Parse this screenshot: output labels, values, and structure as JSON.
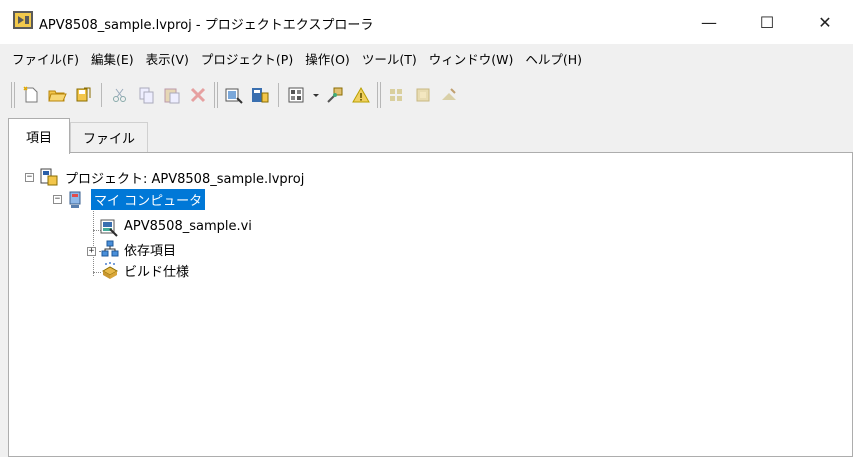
{
  "window": {
    "title": "APV8508_sample.lvproj - プロジェクトエクスプローラ",
    "minimize_glyph": "—",
    "maximize_glyph": "☐",
    "close_glyph": "✕"
  },
  "menu": [
    {
      "label": "ファイル(F)"
    },
    {
      "label": "編集(E)"
    },
    {
      "label": "表示(V)"
    },
    {
      "label": "プロジェクト(P)"
    },
    {
      "label": "操作(O)"
    },
    {
      "label": "ツール(T)"
    },
    {
      "label": "ウィンドウ(W)"
    },
    {
      "label": "ヘルプ(H)"
    }
  ],
  "toolbar": {
    "icons": [
      "new-icon",
      "open-icon",
      "save-all-icon",
      "cut-icon",
      "copy-icon",
      "paste-icon",
      "delete-icon",
      "build-icon",
      "vi-properties-icon",
      "view-options-icon",
      "deploy-icon",
      "warning-icon",
      "build-spec-icon",
      "add-file-icon",
      "remove-icon"
    ]
  },
  "tabs": [
    {
      "label": "項目",
      "active": true
    },
    {
      "label": "ファイル",
      "active": false
    }
  ],
  "tree": {
    "project": {
      "label": "プロジェクト: APV8508_sample.lvproj",
      "expanded": true
    },
    "computer": {
      "label": "マイ コンピュータ",
      "selected": true,
      "expanded": true
    },
    "items": [
      {
        "label": "APV8508_sample.vi",
        "icon": "vi-icon"
      },
      {
        "label": "依存項目",
        "icon": "dependencies-icon",
        "expandable": true
      },
      {
        "label": "ビルド仕様",
        "icon": "build-spec-icon"
      }
    ]
  },
  "colors": {
    "selection": "#0078d7",
    "window_bg": "#f0f0f0"
  }
}
